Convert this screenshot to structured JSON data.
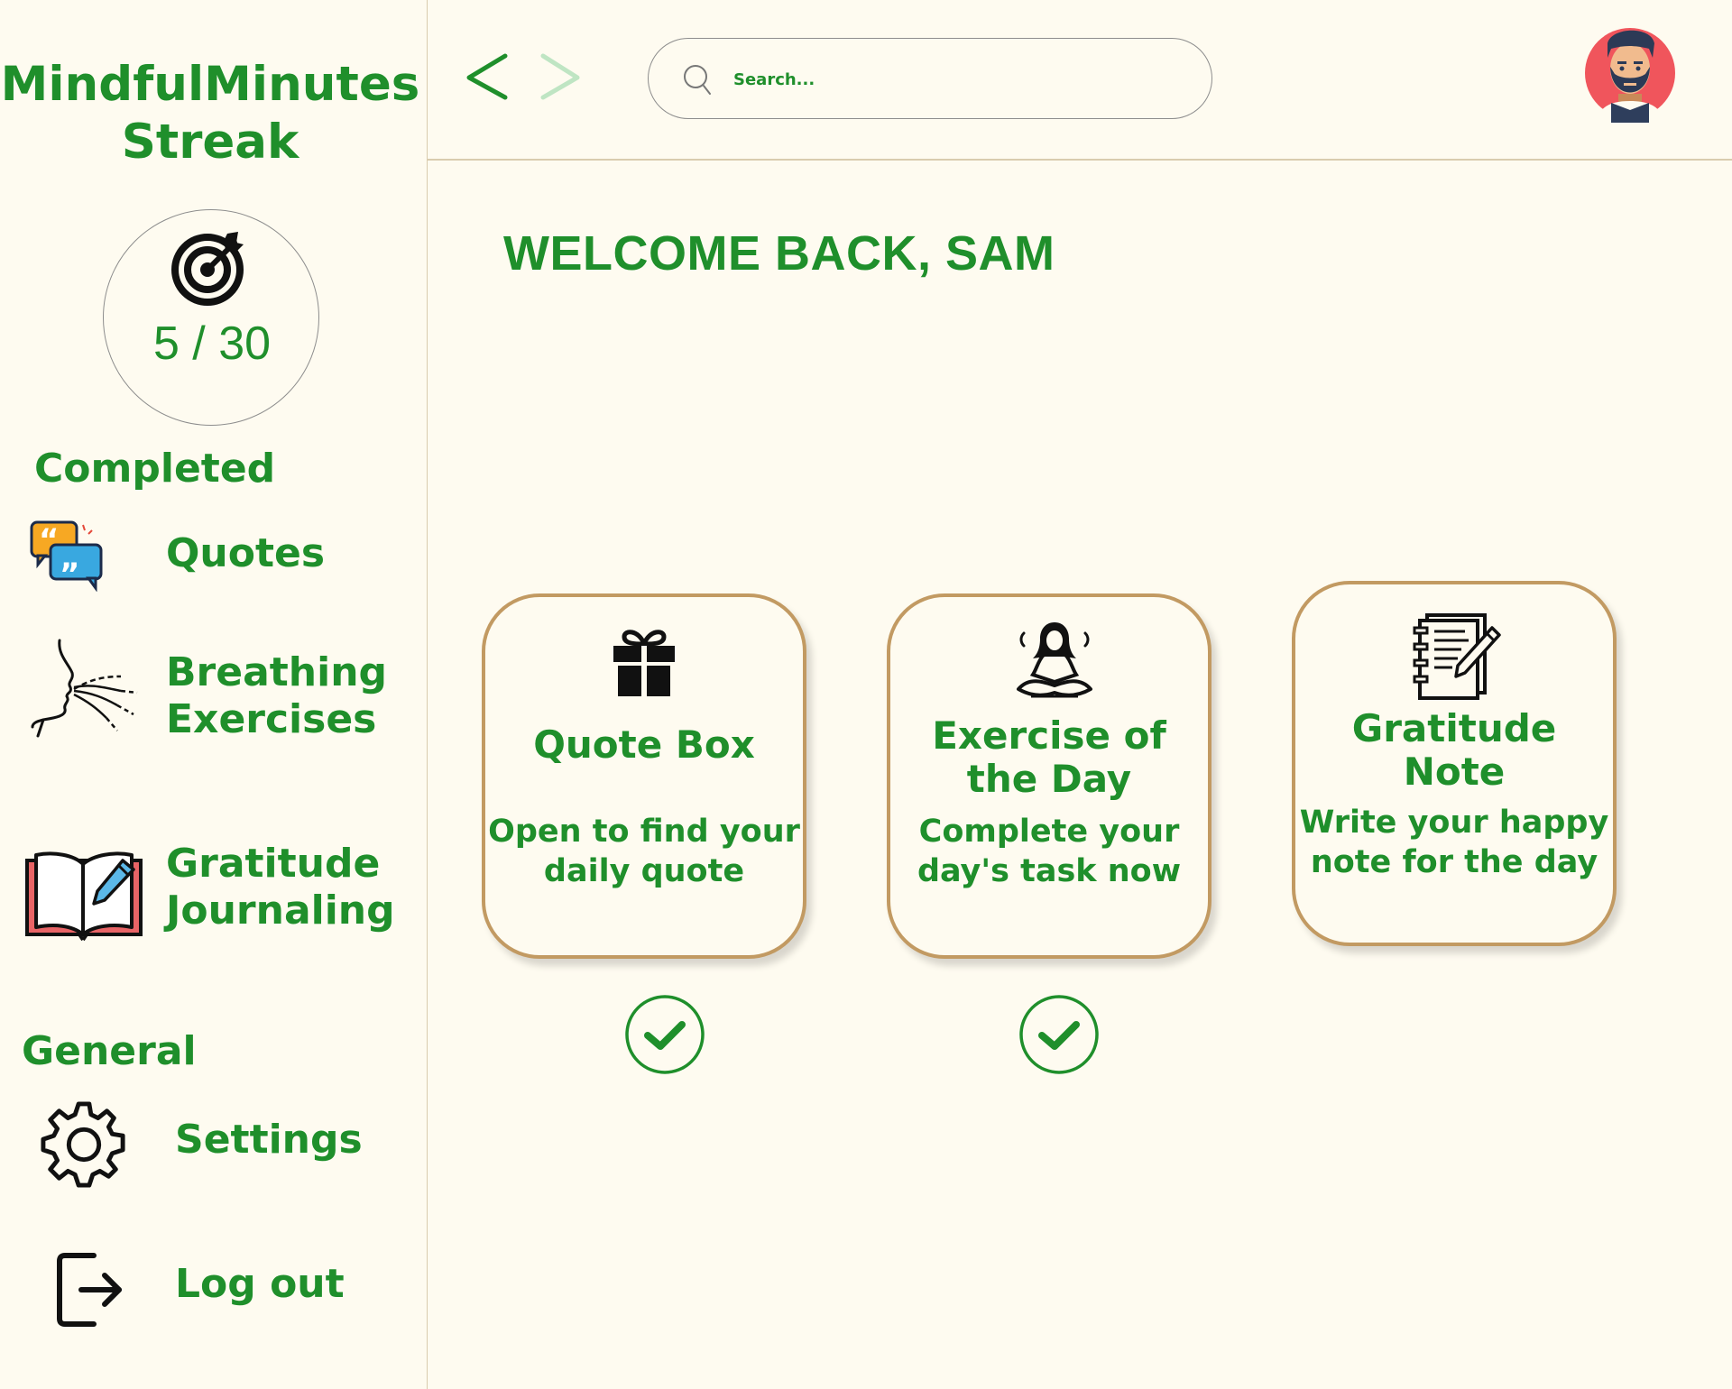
{
  "sidebar": {
    "app_title_line1": "MindfulMinutes",
    "app_title_line2": "Streak",
    "streak": "5 / 30",
    "completed_label": "Completed",
    "general_label": "General",
    "items": [
      {
        "label": "Quotes",
        "icon": "quotes-icon"
      },
      {
        "label_line1": "Breathing",
        "label_line2": "Exercises",
        "icon": "breathing-icon"
      },
      {
        "label_line1": "Gratitude",
        "label_line2": "Journaling",
        "icon": "journal-icon"
      }
    ],
    "settings_label": "Settings",
    "logout_label": "Log out"
  },
  "topbar": {
    "search_placeholder": "Search...",
    "avatar": "avatar-bearded-man"
  },
  "main": {
    "welcome": "WELCOME BACK, SAM",
    "cards": [
      {
        "title_line1": "Quote Box",
        "desc_line1": "Open to find your",
        "desc_line2": "daily quote",
        "icon": "gift-icon",
        "completed": true
      },
      {
        "title_line1": "Exercise of",
        "title_line2": "the Day",
        "desc_line1": "Complete your",
        "desc_line2": "day's task now",
        "icon": "meditation-icon",
        "completed": true
      },
      {
        "title_line1": "Gratitude",
        "title_line2": "Note",
        "desc_line1": "Write your happy",
        "desc_line2": "note for the day",
        "icon": "notepad-icon",
        "completed": false
      }
    ]
  },
  "colors": {
    "accent": "#1f8f2b",
    "background": "#fefbf0",
    "card_border": "#c29a62"
  }
}
